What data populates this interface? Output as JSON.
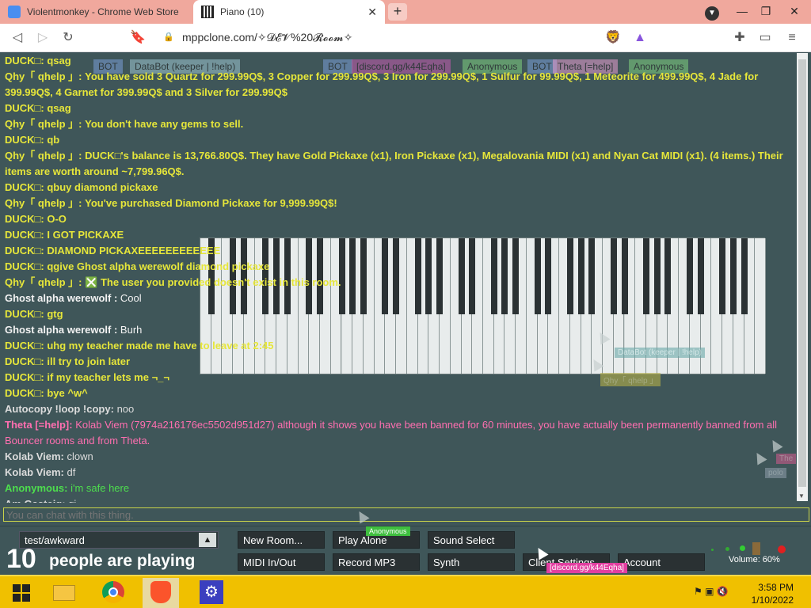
{
  "browser": {
    "tabs": [
      {
        "title": "Violentmonkey - Chrome Web Store"
      },
      {
        "title": "Piano (10)"
      }
    ],
    "url": "mppclone.com/✧𝓓𝓔𝓥%20𝓡𝓸𝓸𝓶✧"
  },
  "nametags": [
    {
      "label": "BOT"
    },
    {
      "label": "DataBot (keeper | !help)"
    },
    {
      "label": "BOT"
    },
    {
      "label": "[discord.gg/k44Eqha]"
    },
    {
      "label": "Anonymous"
    },
    {
      "label": "BOT"
    },
    {
      "label": "Theta [=help]"
    },
    {
      "label": "Anonymous"
    }
  ],
  "chat": {
    "messages": [
      {
        "name": "DUCK□:",
        "text": "qsag",
        "color": "#e6e63a",
        "bold": true
      },
      {
        "name": "Qhy「 qhelp 」:",
        "text": "You have sold 3 Quartz for 299.99Q$, 3 Copper for 299.99Q$, 3 Iron for 299.99Q$, 1 Sulfur for 99.99Q$, 1 Meteorite for 499.99Q$, 4 Jade for 399.99Q$, 4 Garnet for 399.99Q$ and 3 Silver for 299.99Q$",
        "color": "#e6e63a",
        "bold": true
      },
      {
        "name": "DUCK□:",
        "text": "qsag",
        "color": "#e6e63a",
        "bold": true
      },
      {
        "name": "Qhy「 qhelp 」:",
        "text": "You don't have any gems to sell.",
        "color": "#e6e63a",
        "bold": true
      },
      {
        "name": "DUCK□:",
        "text": "qb",
        "color": "#e6e63a",
        "bold": true
      },
      {
        "name": "Qhy「 qhelp 」:",
        "text": "DUCK□'s balance is 13,766.80Q$. They have Gold Pickaxe (x1), Iron Pickaxe (x1), Megalovania MIDI (x1) and Nyan Cat MIDI (x1). (4 items.) Their items are worth around ~7,799.96Q$.",
        "color": "#e6e63a",
        "bold": true
      },
      {
        "name": "DUCK□:",
        "text": "qbuy diamond pickaxe",
        "color": "#e6e63a",
        "bold": true
      },
      {
        "name": "Qhy「 qhelp 」:",
        "text": "You've purchased Diamond Pickaxe for 9,999.99Q$!",
        "color": "#e6e63a",
        "bold": true
      },
      {
        "name": "DUCK□:",
        "text": "O-O",
        "color": "#e6e63a",
        "bold": true
      },
      {
        "name": "DUCK□:",
        "text": "I GOT PICKAXE",
        "color": "#e6e63a",
        "bold": true
      },
      {
        "name": "DUCK□:",
        "text": "DIAMOND PICKAXEEEEEEEEEEEE",
        "color": "#e6e63a",
        "bold": true
      },
      {
        "name": "DUCK□:",
        "text": "qgive Ghost alpha werewolf diamond pickaxe",
        "color": "#e6e63a",
        "bold": true
      },
      {
        "name": "Qhy「 qhelp 」:",
        "text": "❎ The user you provided doesn't exist in this room.",
        "color": "#e6e63a",
        "bold": true
      },
      {
        "name": "Ghost alpha werewolf :",
        "text": "Cool",
        "color": "#f2f2f2",
        "bold": false
      },
      {
        "name": "DUCK□:",
        "text": "gtg",
        "color": "#e6e63a",
        "bold": true
      },
      {
        "name": "Ghost alpha werewolf :",
        "text": "Burh",
        "color": "#f2f2f2",
        "bold": false
      },
      {
        "name": "DUCK□:",
        "text": "uhg my teacher made me have to leave at 2:45",
        "color": "#e6e63a",
        "bold": true
      },
      {
        "name": "DUCK□:",
        "text": "ill try to join later",
        "color": "#e6e63a",
        "bold": true
      },
      {
        "name": "DUCK□:",
        "text": "if my teacher lets me ¬_¬",
        "color": "#e6e63a",
        "bold": true
      },
      {
        "name": "DUCK□:",
        "text": "bye ^w^",
        "color": "#e6e63a",
        "bold": true
      },
      {
        "name": "Autocopy !loop !copy:",
        "text": "noo",
        "color": "#dcdcdc",
        "bold": false
      },
      {
        "name": "Theta [=help]:",
        "text": "Kolab Viem (7974a216176ec5502d951d27) although it shows you have been banned for 60 minutes, you have actually been permanently banned from all Bouncer rooms and from Theta.",
        "color": "#ff6fb0",
        "bold": false
      },
      {
        "name": "Kolab Viem:",
        "text": "clown",
        "color": "#dcdcdc",
        "bold": false
      },
      {
        "name": "Kolab Viem:",
        "text": "df",
        "color": "#dcdcdc",
        "bold": false
      },
      {
        "name": "Anonymous:",
        "text": "i'm safe here",
        "color": "#4dde4d",
        "bold": false
      },
      {
        "name": "Am Gasteig:",
        "text": "qi",
        "color": "#dcdcdc",
        "bold": false
      }
    ],
    "input_placeholder": "You can chat with this thing."
  },
  "cursor_tags": [
    {
      "label": "DataBot (keeper | !help)"
    },
    {
      "label": "Qhy「 qhelp 」"
    },
    {
      "label": "Anonymous"
    },
    {
      "label": "[discord.gg/k44Eqha]"
    },
    {
      "label": "The"
    },
    {
      "label": "polo"
    }
  ],
  "controls": {
    "room_name": "test/awkward",
    "player_count": "10",
    "player_count_label": "people are playing",
    "buttons": {
      "new_room": "New Room...",
      "play_alone": "Play Alone",
      "sound_select": "Sound Select",
      "midi": "MIDI In/Out",
      "record": "Record MP3",
      "synth": "Synth",
      "client_settings": "Client Settings",
      "account": "Account"
    },
    "volume": "Volume: 60%"
  },
  "taskbar": {
    "time": "3:58 PM",
    "date": "1/10/2022"
  }
}
